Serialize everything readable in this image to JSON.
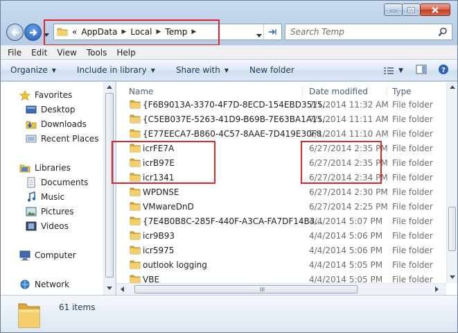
{
  "window": {
    "accent": "#e0242a",
    "captions": [
      "minimize-icon",
      "maximize-icon",
      "close-icon"
    ]
  },
  "address": {
    "overflow": "«",
    "crumbs": [
      "AppData",
      "Local",
      "Temp"
    ]
  },
  "search": {
    "placeholder": "Search Temp"
  },
  "menu": {
    "file": "File",
    "edit": "Edit",
    "view": "View",
    "tools": "Tools",
    "help": "Help"
  },
  "toolbar": {
    "organize": "Organize",
    "include": "Include in library",
    "share": "Share with",
    "new_folder": "New folder"
  },
  "nav": {
    "favorites": "Favorites",
    "desktop": "Desktop",
    "downloads": "Downloads",
    "recent": "Recent Places",
    "libraries": "Libraries",
    "documents": "Documents",
    "music": "Music",
    "pictures": "Pictures",
    "videos": "Videos",
    "computer": "Computer",
    "network": "Network"
  },
  "columns": {
    "name": "Name",
    "date": "Date modified",
    "type": "Type"
  },
  "files": [
    {
      "name": "{F6B9013A-3370-4F7D-8ECD-154EBD3515...",
      "date": "7/1/2014 11:32 AM",
      "type": "File folder"
    },
    {
      "name": "{C5EB037E-5263-41D9-B69B-7E63BA1A15...",
      "date": "7/1/2014 11:11 AM",
      "type": "File folder"
    },
    {
      "name": "{E77EECA7-B860-4C57-8AAE-7D419E30F8...",
      "date": "7/1/2014 11:10 AM",
      "type": "File folder"
    },
    {
      "name": "icrFE7A",
      "date": "6/27/2014 2:35 PM",
      "type": "File folder"
    },
    {
      "name": "icrB97E",
      "date": "6/27/2014 2:35 PM",
      "type": "File folder"
    },
    {
      "name": "icr1341",
      "date": "6/27/2014 2:34 PM",
      "type": "File folder"
    },
    {
      "name": "WPDNSE",
      "date": "6/27/2014 2:30 PM",
      "type": "File folder"
    },
    {
      "name": "VMwareDnD",
      "date": "6/27/2014 2:25 PM",
      "type": "File folder"
    },
    {
      "name": "{7E4B0B8C-285F-440F-A3CA-FA7DF14B3...",
      "date": "4/4/2014 5:07 PM",
      "type": "File folder"
    },
    {
      "name": "icr9B93",
      "date": "4/4/2014 5:06 PM",
      "type": "File folder"
    },
    {
      "name": "icr5975",
      "date": "4/4/2014 5:06 PM",
      "type": "File folder"
    },
    {
      "name": "outlook logging",
      "date": "4/4/2014 5:05 PM",
      "type": "File folder"
    },
    {
      "name": "VBE",
      "date": "4/4/2014 5:05 PM",
      "type": "File folder"
    }
  ],
  "details": {
    "count": "61 items"
  }
}
